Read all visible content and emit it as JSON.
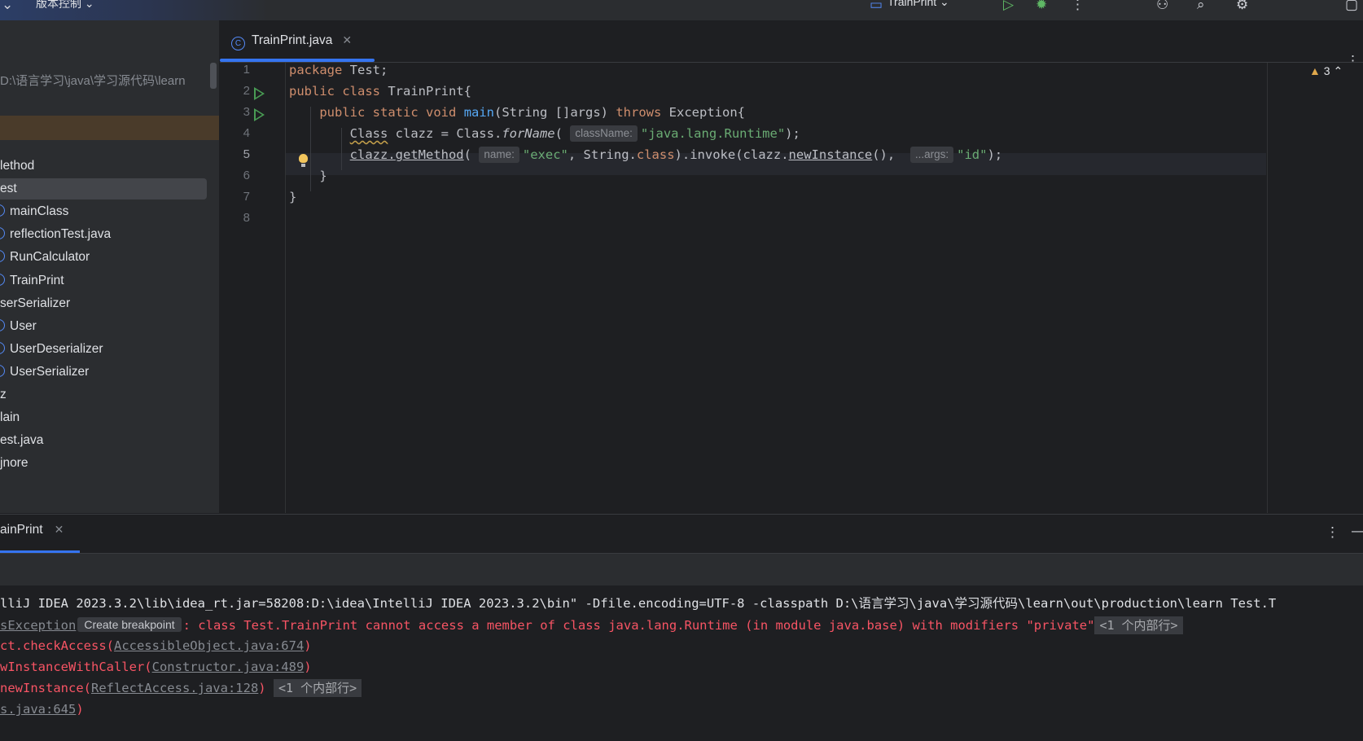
{
  "topbar": {
    "vcs_label": "版本控制 ⌄",
    "run_config": "TrainPrint ⌄"
  },
  "project": {
    "path": "D:\\语言学习\\java\\学习源代码\\learn",
    "items": [
      {
        "label": "lethod",
        "icon": false
      },
      {
        "label": "est",
        "icon": false,
        "selected": true
      },
      {
        "label": "mainClass",
        "icon": true
      },
      {
        "label": "reflectionTest.java",
        "icon": true
      },
      {
        "label": "RunCalculator",
        "icon": true
      },
      {
        "label": "TrainPrint",
        "icon": true
      },
      {
        "label": "serSerializer",
        "icon": false
      },
      {
        "label": "User",
        "icon": true
      },
      {
        "label": "UserDeserializer",
        "icon": true
      },
      {
        "label": "UserSerializer",
        "icon": true
      },
      {
        "label": "z",
        "icon": false
      },
      {
        "label": "lain",
        "icon": false
      },
      {
        "label": "est.java",
        "icon": false
      },
      {
        "label": "jnore",
        "icon": false
      }
    ]
  },
  "editor": {
    "tab_label": "TrainPrint.java",
    "tab_icon": "C",
    "line_numbers": [
      "1",
      "2",
      "3",
      "4",
      "5",
      "6",
      "7",
      "8"
    ],
    "warning_count": "3",
    "code": {
      "l1_kw": "package",
      "l1_rest": " Test;",
      "l2_kw1": "public",
      "l2_kw2": "class",
      "l2_rest": " TrainPrint{",
      "l3_kw1": "public",
      "l3_kw2": "static",
      "l3_kw3": "void",
      "l3_fn": "main",
      "l3_mid": "(String []args) ",
      "l3_kw4": "throws",
      "l3_rest": " Exception{",
      "l4_a": "Class",
      "l4_b": " clazz = Class.",
      "l4_fn": "forName",
      "l4_paren": "(",
      "l4_hint": "className:",
      "l4_str": "\"java.lang.Runtime\"",
      "l4_end": ");",
      "l5_a": "clazz.",
      "l5_fn": "getMethod",
      "l5_paren": "(",
      "l5_hint1": "name:",
      "l5_str1": "\"exec\"",
      "l5_b": ", String.",
      "l5_kw": "class",
      "l5_c": ").invoke(clazz.",
      "l5_fn2": "newInstance",
      "l5_d": "(), ",
      "l5_hint2": "...args:",
      "l5_str2": "\"id\"",
      "l5_end": ");",
      "l6": "}",
      "l7": "}"
    }
  },
  "run": {
    "tab_label": "ainPrint",
    "cmd_line": "lliJ IDEA 2023.3.2\\lib\\idea_rt.jar=58208:D:\\idea\\IntelliJ IDEA 2023.3.2\\bin\" -Dfile.encoding=UTF-8 -classpath D:\\语言学习\\java\\学习源代码\\learn\\out\\production\\learn Test.T",
    "err1_link": "sException",
    "err1_button": "Create breakpoint",
    "err1_msg": ": class Test.TrainPrint cannot access a member of class java.lang.Runtime (in module java.base) with modifiers \"private\"",
    "err1_badge": "<1 个内部行>",
    "err2_pre": "ct.checkAccess(",
    "err2_link": "AccessibleObject.java:674",
    "err2_post": ")",
    "err3_pre": "wInstanceWithCaller(",
    "err3_link": "Constructor.java:489",
    "err3_post": ")",
    "err4_pre": "newInstance(",
    "err4_link": "ReflectAccess.java:128",
    "err4_post": ")",
    "err4_badge": "<1 个内部行>",
    "err5_link": "s.java:645",
    "err5_post": ")"
  }
}
